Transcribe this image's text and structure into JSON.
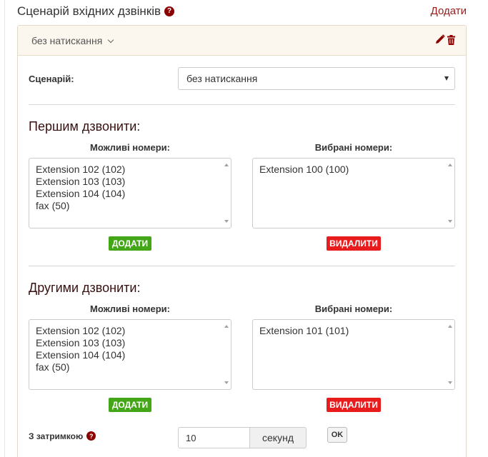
{
  "header": {
    "title": "Сценарій вхідних дзвінків",
    "help_glyph": "?",
    "add_label": "Додати"
  },
  "panel": {
    "current_scenario": "без натискання",
    "scenario_label": "Сценарій:",
    "scenario_select_value": "без натискання"
  },
  "groups": [
    {
      "title": "Першим дзвонити:",
      "available_label": "Можливі номери:",
      "selected_label": "Вибрані номери:",
      "available": [
        "Extension 102 (102)",
        "Extension 103 (103)",
        "Extension 104 (104)",
        "fax (50)"
      ],
      "selected": [
        "Extension 100 (100)"
      ],
      "add_button": "ДОДАТИ",
      "remove_button": "ВИДАЛИТИ"
    },
    {
      "title": "Другими дзвонити:",
      "available_label": "Можливі номери:",
      "selected_label": "Вибрані номери:",
      "available": [
        "Extension 102 (102)",
        "Extension 103 (103)",
        "Extension 104 (104)",
        "fax (50)"
      ],
      "selected": [
        "Extension 101 (101)"
      ],
      "add_button": "ДОДАТИ",
      "remove_button": "ВИДАЛИТИ"
    }
  ],
  "delay": {
    "label": "З затримкою",
    "value": "10",
    "unit": "секунд",
    "ok_label": "OK"
  },
  "colors": {
    "accent": "#8b0000",
    "add_green": "#43a616",
    "remove_red": "#e81c1c"
  }
}
